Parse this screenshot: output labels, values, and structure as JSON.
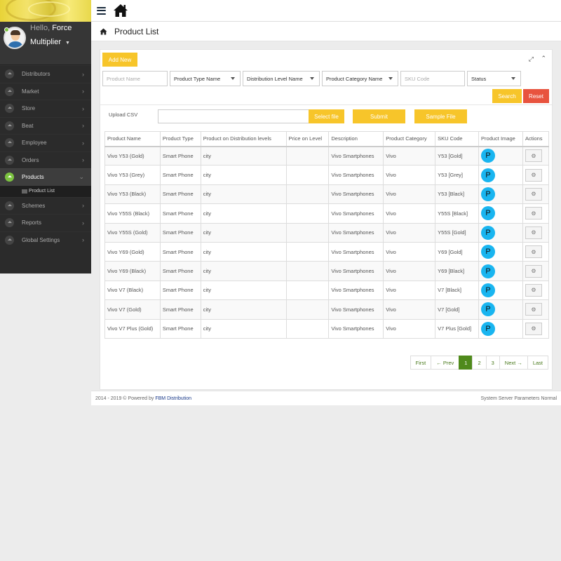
{
  "user": {
    "greeting": "Hello,",
    "name": "Force Multiplier"
  },
  "sidebar": {
    "items": [
      {
        "label": "Distributors",
        "active": false
      },
      {
        "label": "Market",
        "active": false
      },
      {
        "label": "Store",
        "active": false
      },
      {
        "label": "Beat",
        "active": false
      },
      {
        "label": "Employee",
        "active": false
      },
      {
        "label": "Orders",
        "active": false
      },
      {
        "label": "Products",
        "active": true
      },
      {
        "label": "Schemes",
        "active": false
      },
      {
        "label": "Reports",
        "active": false
      },
      {
        "label": "Global Settings",
        "active": false
      }
    ],
    "sub_item": "Product List"
  },
  "page": {
    "title": "Product List"
  },
  "toolbar": {
    "add_new": "Add New"
  },
  "filters": {
    "product_name_placeholder": "Product Name",
    "product_type": "Product Type Name",
    "distribution_level": "Distribution Level Name",
    "product_category": "Product Category Name",
    "sku_placeholder": "SKU Code",
    "status": "Status",
    "search": "Search",
    "reset": "Reset"
  },
  "upload": {
    "label": "Upload CSV",
    "select_file": "Select file",
    "submit": "Submit",
    "sample_file": "Sample File"
  },
  "table": {
    "headers": [
      "Product Name",
      "Product Type",
      "Product on Distribution levels",
      "Price on Level",
      "Description",
      "Product Category",
      "SKU Code",
      "Product Image",
      "Actions"
    ],
    "rows": [
      [
        "Vivo Y53 (Gold)",
        "Smart Phone",
        "city",
        "",
        "Vivo Smartphones",
        "Vivo",
        "Y53 [Gold]",
        "P"
      ],
      [
        "Vivo Y53 (Grey)",
        "Smart Phone",
        "city",
        "",
        "Vivo Smartphones",
        "Vivo",
        "Y53 [Grey]",
        "P"
      ],
      [
        "Vivo Y53 (Black)",
        "Smart Phone",
        "city",
        "",
        "Vivo Smartphones",
        "Vivo",
        "Y53 [Black]",
        "P"
      ],
      [
        "Vivo Y55S (Black)",
        "Smart Phone",
        "city",
        "",
        "Vivo Smartphones",
        "Vivo",
        "Y55S [Black]",
        "P"
      ],
      [
        "Vivo Y55S (Gold)",
        "Smart Phone",
        "city",
        "",
        "Vivo Smartphones",
        "Vivo",
        "Y55S [Gold]",
        "P"
      ],
      [
        "Vivo Y69 (Gold)",
        "Smart Phone",
        "city",
        "",
        "Vivo Smartphones",
        "Vivo",
        "Y69 [Gold]",
        "P"
      ],
      [
        "Vivo Y69 (Black)",
        "Smart Phone",
        "city",
        "",
        "Vivo Smartphones",
        "Vivo",
        "Y69 [Black]",
        "P"
      ],
      [
        "Vivo V7 (Black)",
        "Smart Phone",
        "city",
        "",
        "Vivo Smartphones",
        "Vivo",
        "V7 [Black]",
        "P"
      ],
      [
        "Vivo V7 (Gold)",
        "Smart Phone",
        "city",
        "",
        "Vivo Smartphones",
        "Vivo",
        "V7 [Gold]",
        "P"
      ],
      [
        "Vivo V7 Plus (Gold)",
        "Smart Phone",
        "city",
        "",
        "Vivo Smartphones",
        "Vivo",
        "V7 Plus [Gold]",
        "P"
      ]
    ]
  },
  "pagination": {
    "first": "First",
    "prev": "← Prev",
    "pages": [
      "1",
      "2",
      "3"
    ],
    "current": "1",
    "next": "Next →",
    "last": "Last"
  },
  "footer": {
    "copyright": "2014 - 2019 © Powered by",
    "brand": "FBM Distribution",
    "status": "System Server Parameters Normal"
  },
  "colors": {
    "accent": "#f7c52a",
    "danger": "#e8533e",
    "active_green": "#7cc340",
    "page_green": "#4f8a1b",
    "image_badge": "#19b5f0"
  },
  "icons": [
    "hamburger-icon",
    "home-icon",
    "gear-icon",
    "expand-icon",
    "collapse-icon",
    "chevron-right-icon",
    "caret-down-icon"
  ]
}
